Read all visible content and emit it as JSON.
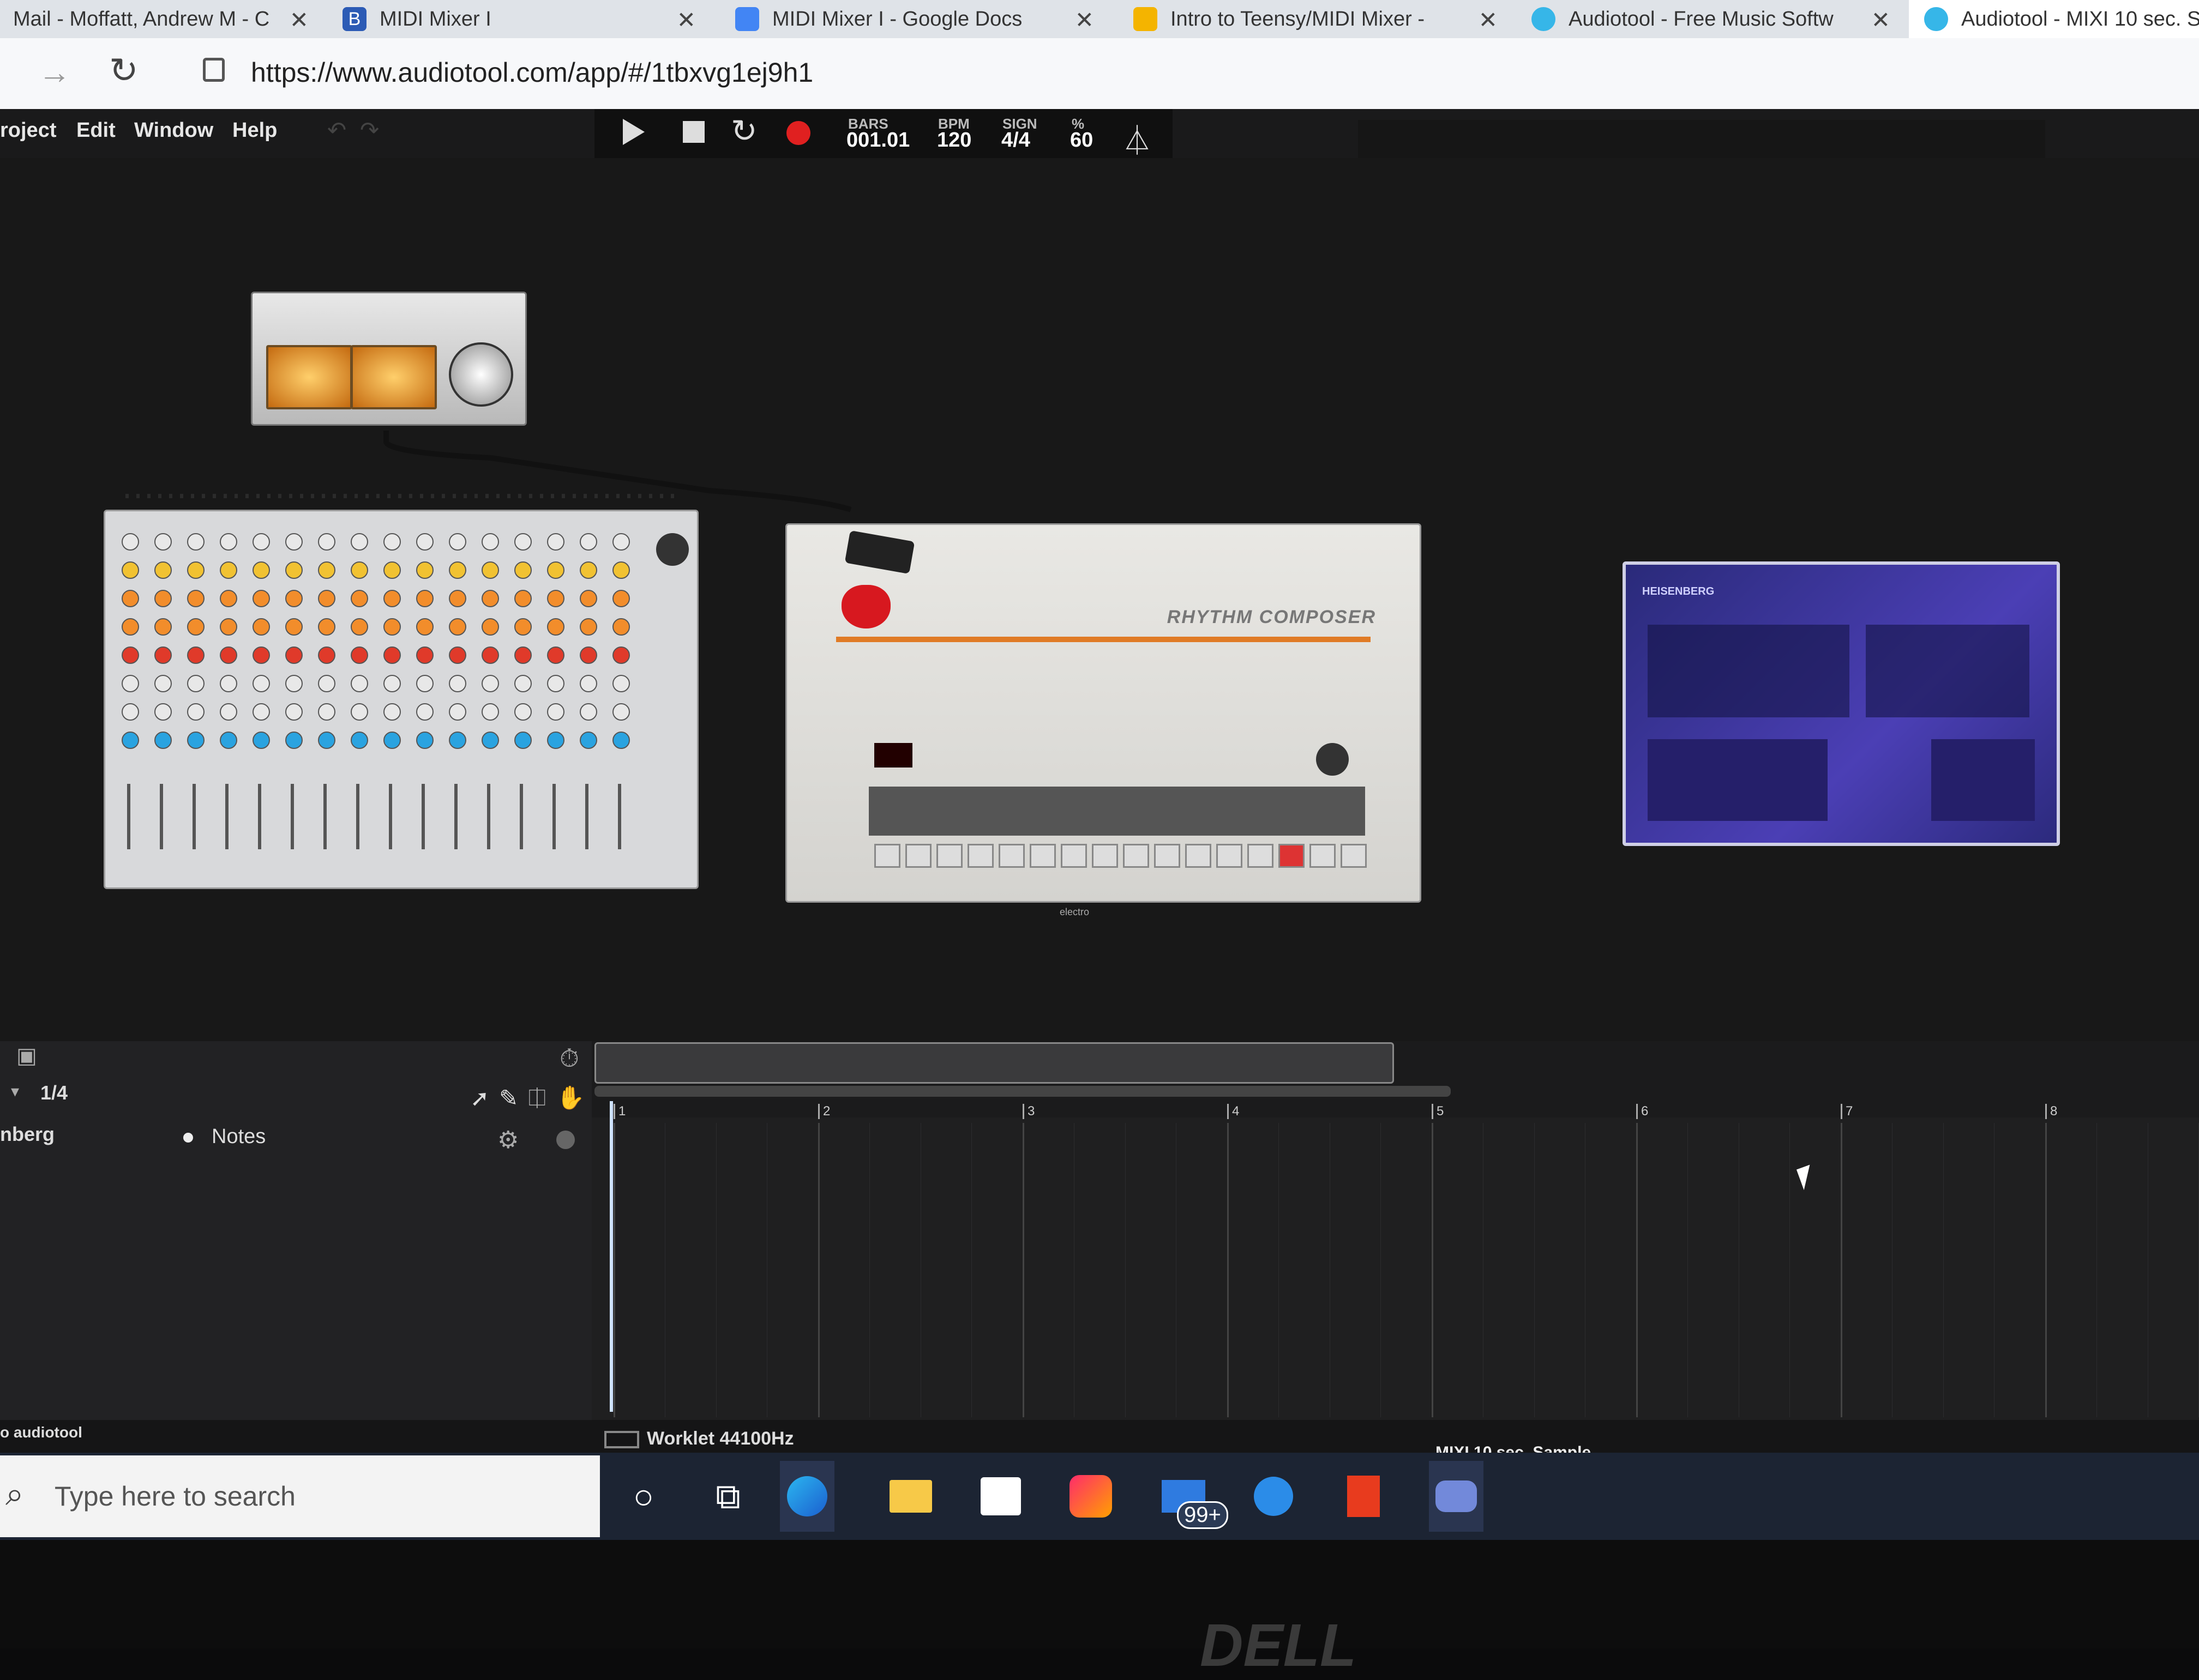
{
  "browser": {
    "tabs": [
      {
        "label": "Mail - Moffatt, Andrew M - C",
        "icon": "mail-icon",
        "color": "#1d6fd1"
      },
      {
        "label": "MIDI Mixer I",
        "icon": "bold-b-icon",
        "color": "#2c5bb5"
      },
      {
        "label": "MIDI Mixer I - Google Docs",
        "icon": "docs-icon",
        "color": "#4285f4"
      },
      {
        "label": "Intro to Teensy/MIDI Mixer -",
        "icon": "slides-icon",
        "color": "#f4b400"
      },
      {
        "label": "Audiotool - Free Music Softw",
        "icon": "audiotool-icon",
        "color": "#36b6e8"
      },
      {
        "label": "Audiotool - MIXI 10 sec. S",
        "icon": "audiotool-icon",
        "color": "#36b6e8"
      }
    ],
    "url": "https://www.audiotool.com/app/#/1tbxvg1ej9h1"
  },
  "menubar": {
    "items": [
      "roject",
      "Edit",
      "Window",
      "Help"
    ]
  },
  "transport": {
    "bars_label": "BARS",
    "bars_value": "001.01",
    "bpm_label": "BPM",
    "bpm_value": "120",
    "sign_label": "SIGN",
    "sign_value": "4/4",
    "swing_label": "%",
    "swing_value": "60"
  },
  "devices": {
    "drum_title": "RHYTHM COMPOSER",
    "drum_tag": "electro",
    "synth_title": "HEISENBERG"
  },
  "timeline": {
    "quantize": "1/4",
    "track_name": "nberg",
    "track_lane": "Notes",
    "bar_numbers": [
      "1",
      "2",
      "3",
      "4",
      "5",
      "6",
      "7",
      "8"
    ],
    "audio_engine": "Worklet 44100Hz",
    "app_label": "o audiotool",
    "project_title": "MIXI 10 sec. Sample"
  },
  "taskbar": {
    "search_placeholder": "Type here to search",
    "mail_badge": "99+"
  },
  "monitor_brand": "DELL"
}
